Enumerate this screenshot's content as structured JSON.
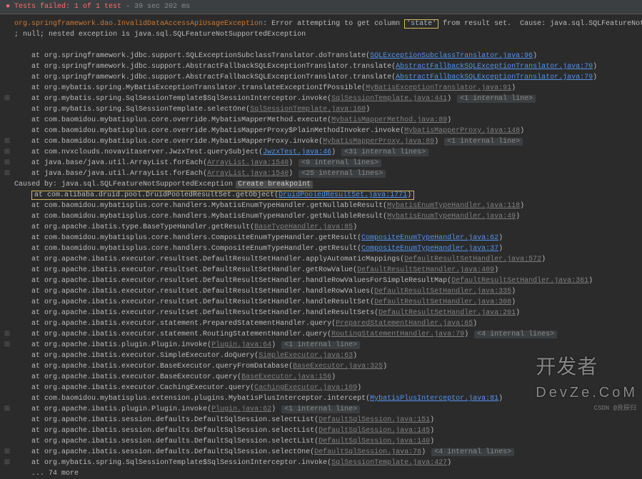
{
  "header": {
    "icon": "●",
    "prefix": "Tests failed:",
    "counts": "1 of 1 test",
    "timing": "– 39 sec 202 ms"
  },
  "exception": {
    "class": "org.springframework.dao.InvalidDataAccessApiUsageException",
    "msg_before": ": Error attempting to get column ",
    "highlighted": "'state'",
    "msg_after": " from result set.  Cause: java.sql.SQLFeatureNotSupportedException",
    "line2": "; null; nested exception is java.sql.SQLFeatureNotSupportedException"
  },
  "frames_top": [
    {
      "at": "at org.springframework.jdbc.support.SQLExceptionSubclassTranslator.doTranslate",
      "link": "SQLExceptionSubclassTranslator.java:96",
      "gutter": ""
    },
    {
      "at": "at org.springframework.jdbc.support.AbstractFallbackSQLExceptionTranslator.translate",
      "link": "AbstractFallbackSQLExceptionTranslator.java:70",
      "gutter": ""
    },
    {
      "at": "at org.springframework.jdbc.support.AbstractFallbackSQLExceptionTranslator.translate",
      "link": "AbstractFallbackSQLExceptionTranslator.java:79",
      "gutter": ""
    },
    {
      "at": "at org.mybatis.spring.MyBatisExceptionTranslator.translateExceptionIfPossible",
      "linkg": "MyBatisExceptionTranslator.java:91",
      "gutter": ""
    },
    {
      "at": "at org.mybatis.spring.SqlSessionTemplate$SqlSessionInterceptor.invoke",
      "linkg": "SqlSessionTemplate.java:441",
      "internal": "<1 internal line>",
      "gutter": "⊞"
    },
    {
      "at": "at org.mybatis.spring.SqlSessionTemplate.selectOne",
      "linkg": "SqlSessionTemplate.java:160",
      "gutter": ""
    },
    {
      "at": "at com.baomidou.mybatisplus.core.override.MybatisMapperMethod.execute",
      "linkg": "MybatisMapperMethod.java:89",
      "gutter": ""
    },
    {
      "at": "at com.baomidou.mybatisplus.core.override.MybatisMapperProxy$PlainMethodInvoker.invoke",
      "linkg": "MybatisMapperProxy.java:148",
      "gutter": ""
    },
    {
      "at": "at com.baomidou.mybatisplus.core.override.MybatisMapperProxy.invoke",
      "linkg": "MybatisMapperProxy.java:89",
      "internal": "<1 internal line>",
      "gutter": "⊞"
    },
    {
      "at": "at com.nvxclouds.novavitaserver.JwzxTest.querySubject",
      "link": "JwzxTest.java:46",
      "internal": "<31 internal lines>",
      "gutter": "⊞"
    },
    {
      "at": "at java.base/java.util.ArrayList.forEach",
      "linkg": "ArrayList.java:1540",
      "internal": "<9 internal lines>",
      "gutter": "⊞"
    },
    {
      "at": "at java.base/java.util.ArrayList.forEach",
      "linkg": "ArrayList.java:1540",
      "internal": "<25 internal lines>",
      "gutter": "⊞"
    }
  ],
  "caused_by": {
    "prefix": "Caused by: ",
    "class": "java.sql.SQLFeatureNotSupportedException",
    "bp": "Create breakpoint"
  },
  "highlight_frame": {
    "at": "at com.alibaba.druid.pool.DruidPooledResultSet.getObject",
    "link": "DruidPooledResultSet.java:1771"
  },
  "frames_bottom": [
    {
      "at": "at com.baomidou.mybatisplus.core.handlers.MybatisEnumTypeHandler.getNullableResult",
      "linkg": "MybatisEnumTypeHandler.java:118"
    },
    {
      "at": "at com.baomidou.mybatisplus.core.handlers.MybatisEnumTypeHandler.getNullableResult",
      "linkg": "MybatisEnumTypeHandler.java:49"
    },
    {
      "at": "at org.apache.ibatis.type.BaseTypeHandler.getResult",
      "linkg": "BaseTypeHandler.java:85"
    },
    {
      "at": "at com.baomidou.mybatisplus.core.handlers.CompositeEnumTypeHandler.getResult",
      "link": "CompositeEnumTypeHandler.java:62"
    },
    {
      "at": "at com.baomidou.mybatisplus.core.handlers.CompositeEnumTypeHandler.getResult",
      "link": "CompositeEnumTypeHandler.java:37"
    },
    {
      "at": "at org.apache.ibatis.executor.resultset.DefaultResultSetHandler.applyAutomaticMappings",
      "linkg": "DefaultResultSetHandler.java:572"
    },
    {
      "at": "at org.apache.ibatis.executor.resultset.DefaultResultSetHandler.getRowValue",
      "linkg": "DefaultResultSetHandler.java:409"
    },
    {
      "at": "at org.apache.ibatis.executor.resultset.DefaultResultSetHandler.handleRowValuesForSimpleResultMap",
      "linkg": "DefaultResultSetHandler.java:361"
    },
    {
      "at": "at org.apache.ibatis.executor.resultset.DefaultResultSetHandler.handleRowValues",
      "linkg": "DefaultResultSetHandler.java:335"
    },
    {
      "at": "at org.apache.ibatis.executor.resultset.DefaultResultSetHandler.handleResultSet",
      "linkg": "DefaultResultSetHandler.java:308"
    },
    {
      "at": "at org.apache.ibatis.executor.resultset.DefaultResultSetHandler.handleResultSets",
      "linkg": "DefaultResultSetHandler.java:201"
    },
    {
      "at": "at org.apache.ibatis.executor.statement.PreparedStatementHandler.query",
      "linkg": "PreparedStatementHandler.java:65"
    },
    {
      "at": "at org.apache.ibatis.executor.statement.RoutingStatementHandler.query",
      "linkg": "RoutingStatementHandler.java:79",
      "internal": "<4 internal lines>",
      "gutter": "⊞"
    },
    {
      "at": "at org.apache.ibatis.plugin.Plugin.invoke",
      "linkg": "Plugin.java:64",
      "internal": "<1 internal line>",
      "gutter": "⊞"
    },
    {
      "at": "at org.apache.ibatis.executor.SimpleExecutor.doQuery",
      "linkg": "SimpleExecutor.java:63"
    },
    {
      "at": "at org.apache.ibatis.executor.BaseExecutor.queryFromDatabase",
      "linkg": "BaseExecutor.java:325"
    },
    {
      "at": "at org.apache.ibatis.executor.BaseExecutor.query",
      "linkg": "BaseExecutor.java:156"
    },
    {
      "at": "at org.apache.ibatis.executor.CachingExecutor.query",
      "linkg": "CachingExecutor.java:109"
    },
    {
      "at": "at com.baomidou.mybatisplus.extension.plugins.MybatisPlusInterceptor.intercept",
      "link": "MybatisPlusInterceptor.java:81"
    },
    {
      "at": "at org.apache.ibatis.plugin.Plugin.invoke",
      "linkg": "Plugin.java:62",
      "internal": "<1 internal line>",
      "gutter": "⊞"
    },
    {
      "at": "at org.apache.ibatis.session.defaults.DefaultSqlSession.selectList",
      "linkg": "DefaultSqlSession.java:151"
    },
    {
      "at": "at org.apache.ibatis.session.defaults.DefaultSqlSession.selectList",
      "linkg": "DefaultSqlSession.java:145"
    },
    {
      "at": "at org.apache.ibatis.session.defaults.DefaultSqlSession.selectList",
      "linkg": "DefaultSqlSession.java:140"
    },
    {
      "at": "at org.apache.ibatis.session.defaults.DefaultSqlSession.selectOne",
      "linkg": "DefaultSqlSession.java:76",
      "internal": "<4 internal lines>",
      "gutter": "⊞"
    },
    {
      "at": "at org.mybatis.spring.SqlSessionTemplate$SqlSessionInterceptor.invoke",
      "linkg": "SqlSessionTemplate.java:427",
      "gutter": "⊞"
    }
  ],
  "more": "... 74 more",
  "watermark": {
    "brand": "开发者",
    "host": "DevZe.CoM",
    "sub": "CSDN @良辰归"
  }
}
